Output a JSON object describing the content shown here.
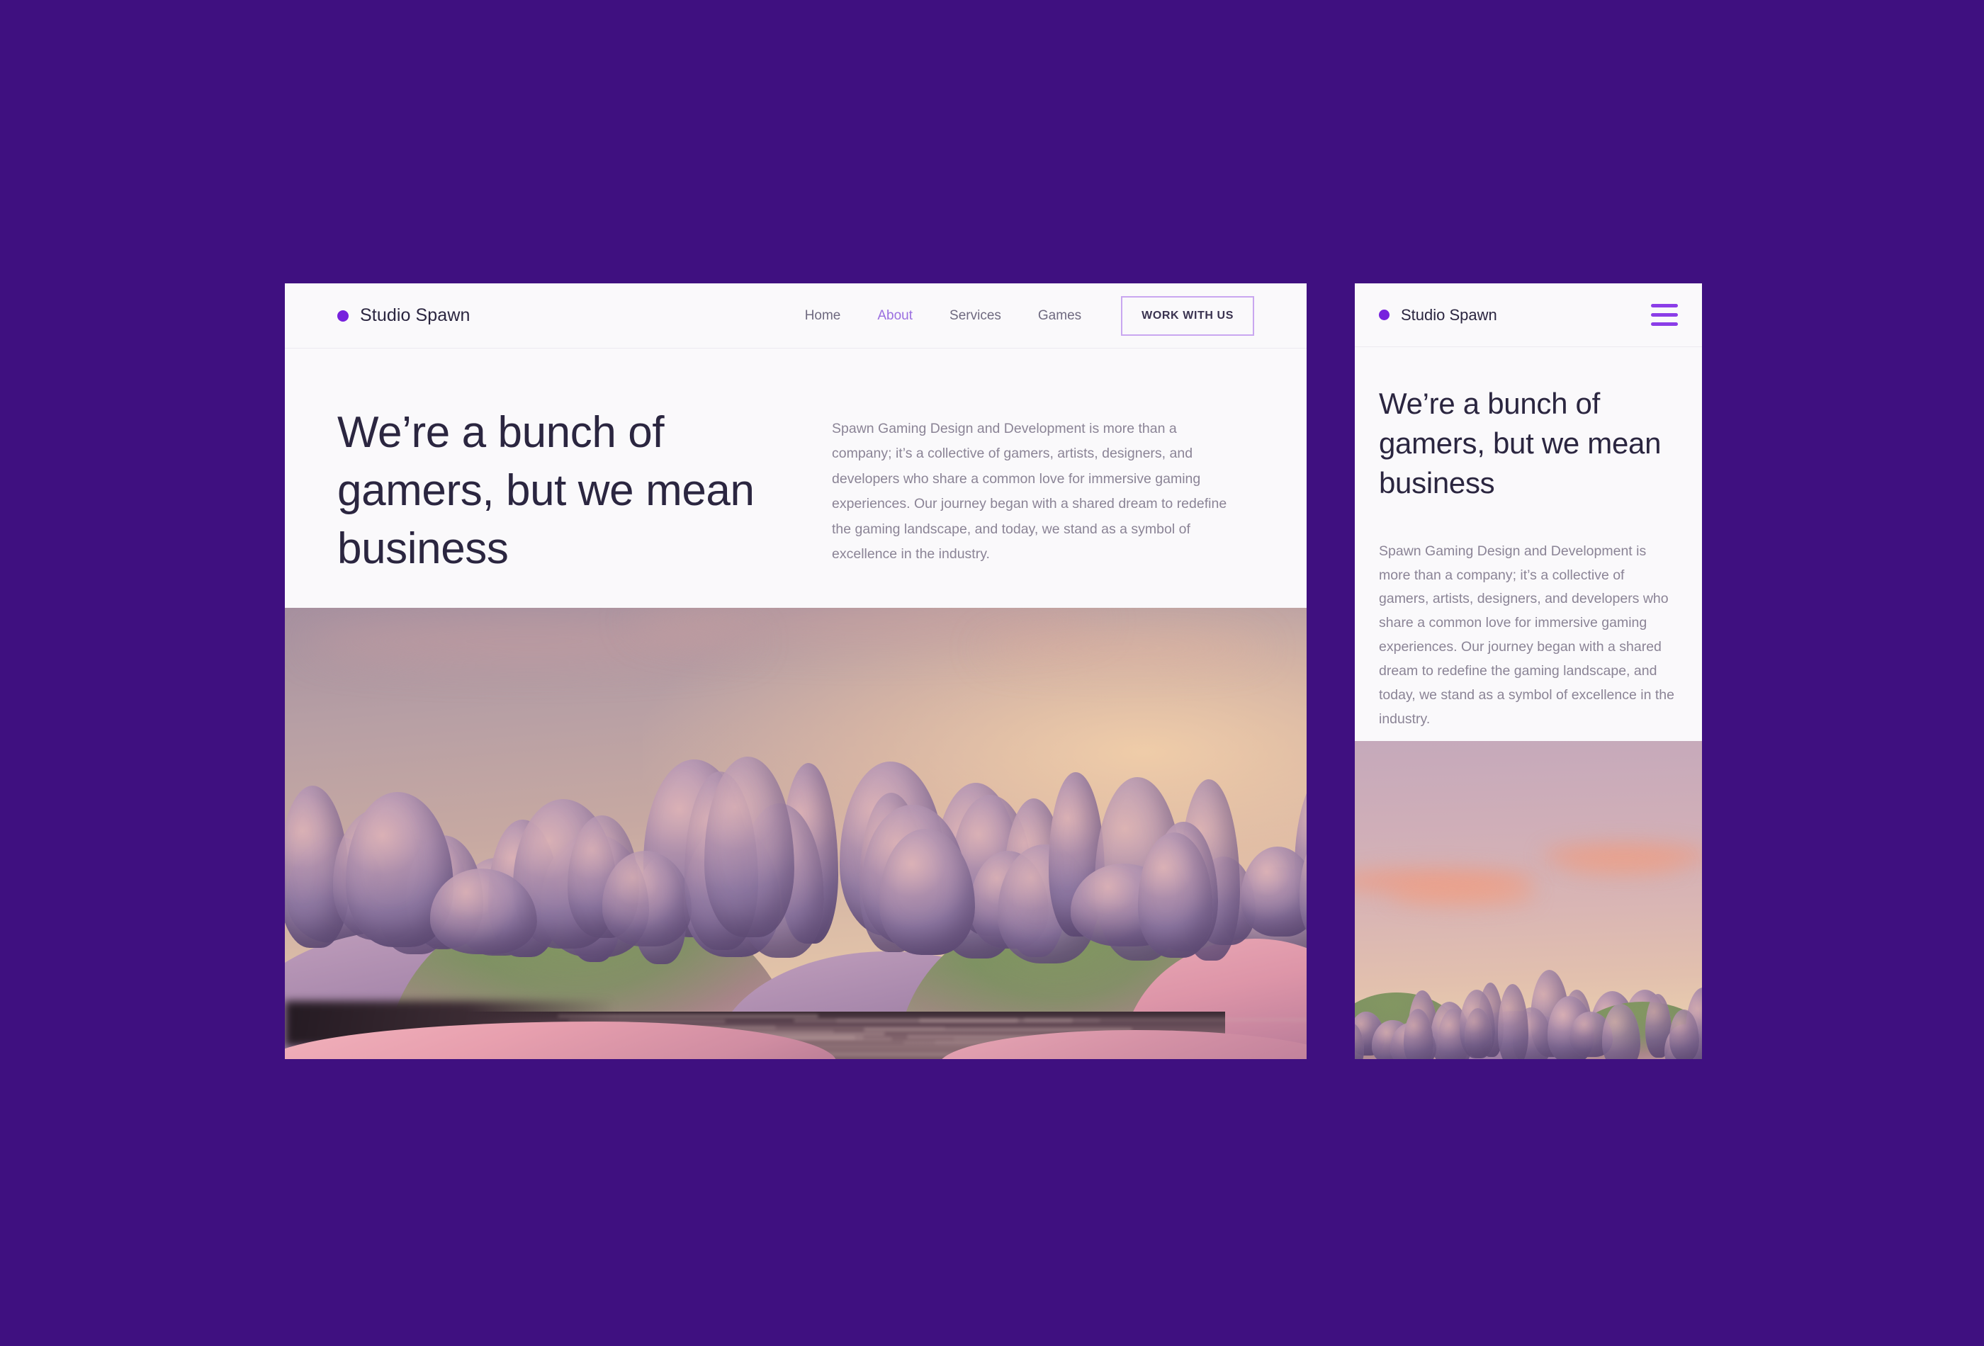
{
  "theme": {
    "page_background": "#3f1080",
    "card_background": "#faf9fb",
    "accent_purple": "#7722dd",
    "heading_color": "#2b2640",
    "body_text_color": "#8b8496",
    "cta_border_color": "#c9a7f0",
    "active_nav_color": "#9b6fe0",
    "hamburger_color": "#8b3de8"
  },
  "desktop": {
    "brand": {
      "name": "Studio Spawn",
      "logo_icon": "dot-icon"
    },
    "nav_links": [
      {
        "label": "Home",
        "active": false
      },
      {
        "label": "About",
        "active": true
      },
      {
        "label": "Services",
        "active": false
      },
      {
        "label": "Games",
        "active": false
      }
    ],
    "cta_label": "WORK WITH US",
    "hero": {
      "heading": "We’re a bunch of gamers, but we mean business",
      "paragraph": "Spawn Gaming Design and Development is more than a company; it’s a collective of gamers, artists, designers, and developers who share a common love for immersive gaming experiences. Our journey began with a shared dream to redefine the gaming landscape, and today, we stand as a symbol of excellence in the industry.",
      "image_alt": "surreal pink and purple sunset landscape with trees, rolling hills and a lake"
    }
  },
  "mobile": {
    "brand": {
      "name": "Studio Spawn",
      "logo_icon": "dot-icon"
    },
    "menu_icon": "hamburger-icon",
    "hero": {
      "heading": "We’re a bunch of gamers, but we mean business",
      "paragraph": "Spawn Gaming Design and Development is more than a company; it’s a collective of gamers, artists, designers, and developers who share a common love for immersive gaming experiences. Our journey began with a shared dream to redefine the gaming landscape, and today, we stand as a symbol of excellence in the industry.",
      "image_alt": "surreal pink sunset sky with salmon clouds above purple treeline and green hills"
    }
  }
}
